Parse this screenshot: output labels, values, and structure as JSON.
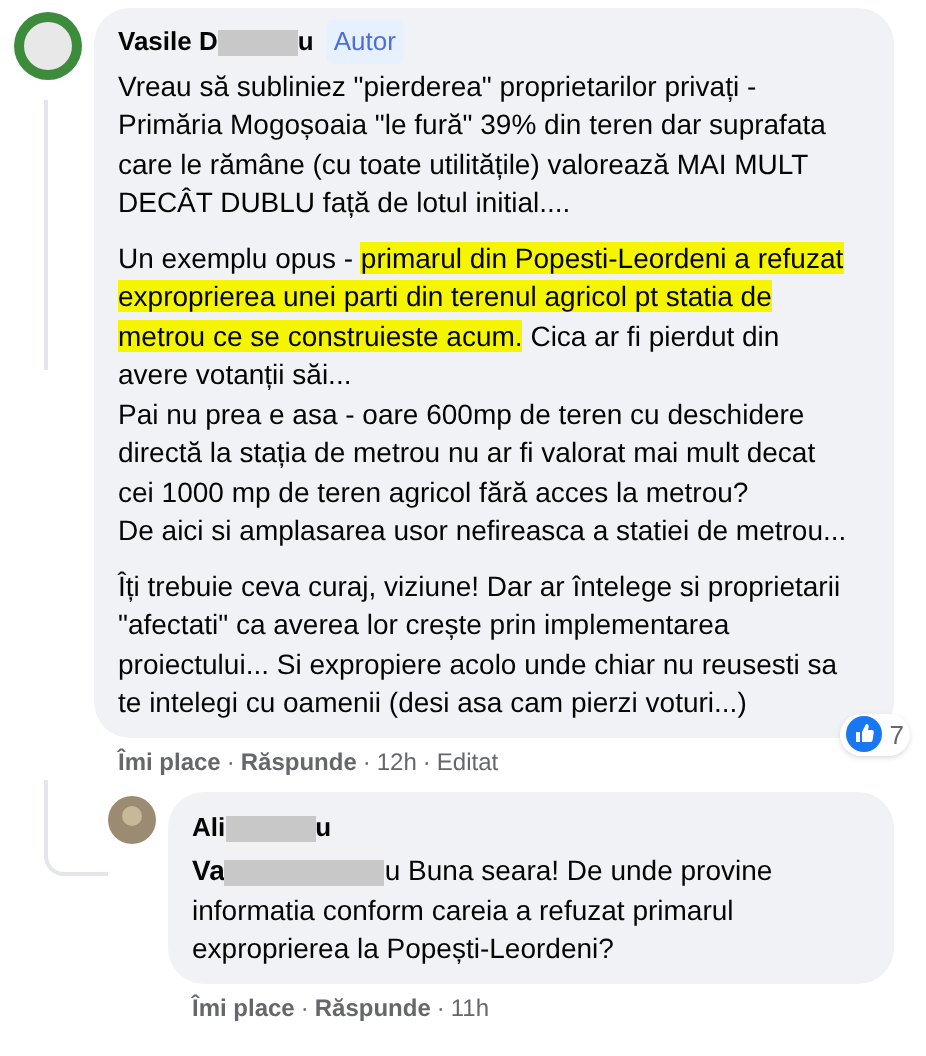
{
  "comment": {
    "author_start": "Vasile D",
    "author_end": "u",
    "badge": "Autor",
    "paragraphs": [
      {
        "segments": [
          {
            "text": "Vreau să subliniez \"pierderea\" proprietarilor privați - Primăria Mogoșoaia \"le fură\" 39% din teren dar suprafata care le rămâne (cu toate utilitățile) valorează MAI MULT DECÂT DUBLU față de lotul initial....",
            "highlighted": false
          }
        ]
      },
      {
        "segments": [
          {
            "text": "Un exemplu opus - ",
            "highlighted": false
          },
          {
            "text": "primarul din Popesti-Leordeni a refuzat exproprierea unei parti din terenul agricol pt statia de metrou ce se construieste acum.",
            "highlighted": true
          },
          {
            "text": " Cica ar fi pierdut din avere votanții săi...",
            "highlighted": false
          }
        ]
      },
      {
        "segments": [
          {
            "text": "Pai nu prea e asa - oare 600mp de teren cu deschidere directă la stația de metrou nu ar fi valorat mai mult decat cei 1000 mp de teren agricol fără acces la metrou?",
            "highlighted": false
          }
        ]
      },
      {
        "segments": [
          {
            "text": "De aici si amplasarea usor nefireasca a statiei de metrou...",
            "highlighted": false
          }
        ]
      },
      {
        "segments": [
          {
            "text": "Îți trebuie ceva curaj, viziune! Dar ar întelege si proprietarii \"afectati\" ca averea lor crește prin implementarea proiectului... Si expropiere acolo unde chiar nu reusesti sa te intelegi cu oamenii (desi asa cam pierzi voturi...)",
            "highlighted": false
          }
        ]
      }
    ],
    "reactions": "7",
    "separator": "·",
    "actions": [
      {
        "text": "Îmi place",
        "kind": "link"
      },
      {
        "text": "Răspunde",
        "kind": "link"
      },
      {
        "text": "12h",
        "kind": "meta"
      },
      {
        "text": "Editat",
        "kind": "meta"
      }
    ]
  },
  "reply": {
    "separator": "·",
    "author_start": "Ali",
    "author_end": "u",
    "mention_start": "Va",
    "text": "u Buna seara! De unde provine informatia conform careia a refuzat primarul exproprierea la Popești-Leordeni?",
    "actions": [
      {
        "text": "Îmi place",
        "kind": "link"
      },
      {
        "text": "Răspunde",
        "kind": "link"
      },
      {
        "text": "11h",
        "kind": "meta"
      }
    ]
  }
}
